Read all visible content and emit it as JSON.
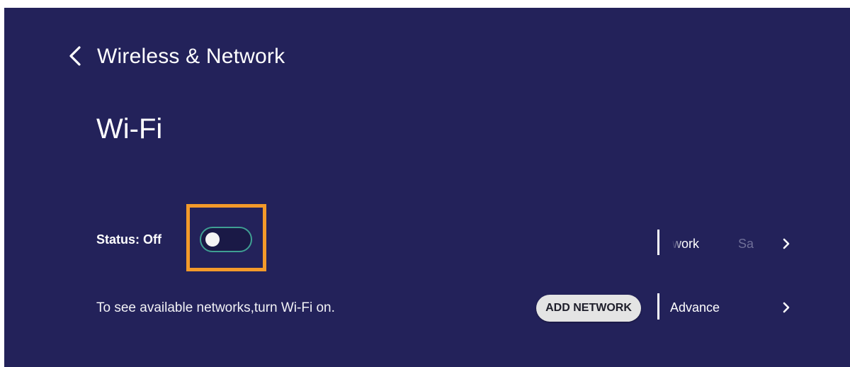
{
  "header": {
    "back_icon": "chevron-left-icon",
    "title": "Wireless & Network"
  },
  "page": {
    "title": "Wi-Fi"
  },
  "wifi": {
    "status_label": "Status: Off",
    "toggle_state": "off",
    "hint": "To see available networks,turn Wi-Fi on.",
    "add_network_label": "ADD NETWORK"
  },
  "menu": {
    "items": [
      {
        "label_visible": "work",
        "label_faded": "Sa",
        "chevron_icon": "chevron-right-icon"
      },
      {
        "label": "Advance",
        "chevron_icon": "chevron-right-icon"
      }
    ]
  },
  "colors": {
    "background": "#23225a",
    "highlight": "#f39a2a",
    "toggle_border": "#3f9f93",
    "button_bg": "#e4e4e4"
  }
}
